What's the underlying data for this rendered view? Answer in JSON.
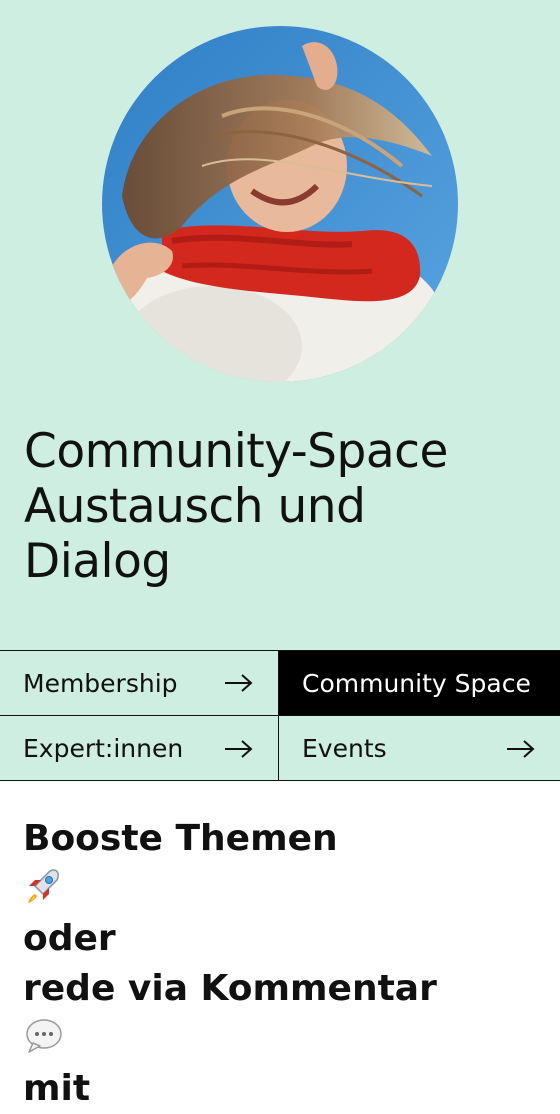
{
  "hero": {
    "image_alt": "Woman with windblown hair in red and white scarf",
    "title_lines": [
      "Community-Space",
      "Austausch und",
      "Dialog"
    ]
  },
  "nav": {
    "items": [
      {
        "label": "Membership",
        "active": false,
        "icon": "arrow-right-icon"
      },
      {
        "label": "Community Space",
        "active": true,
        "icon": null
      },
      {
        "label": "Expert:innen",
        "active": false,
        "icon": "arrow-right-icon"
      },
      {
        "label": "Events",
        "active": false,
        "icon": "arrow-right-icon"
      }
    ]
  },
  "content": {
    "heading_lines": [
      "Booste Themen",
      "oder",
      "rede via Kommentar",
      "mit"
    ],
    "emojis": [
      "rocket-emoji",
      "speech-bubble-emoji"
    ]
  },
  "colors": {
    "hero_bg": "#cdeee0",
    "active_bg": "#000000",
    "text": "#111111"
  }
}
